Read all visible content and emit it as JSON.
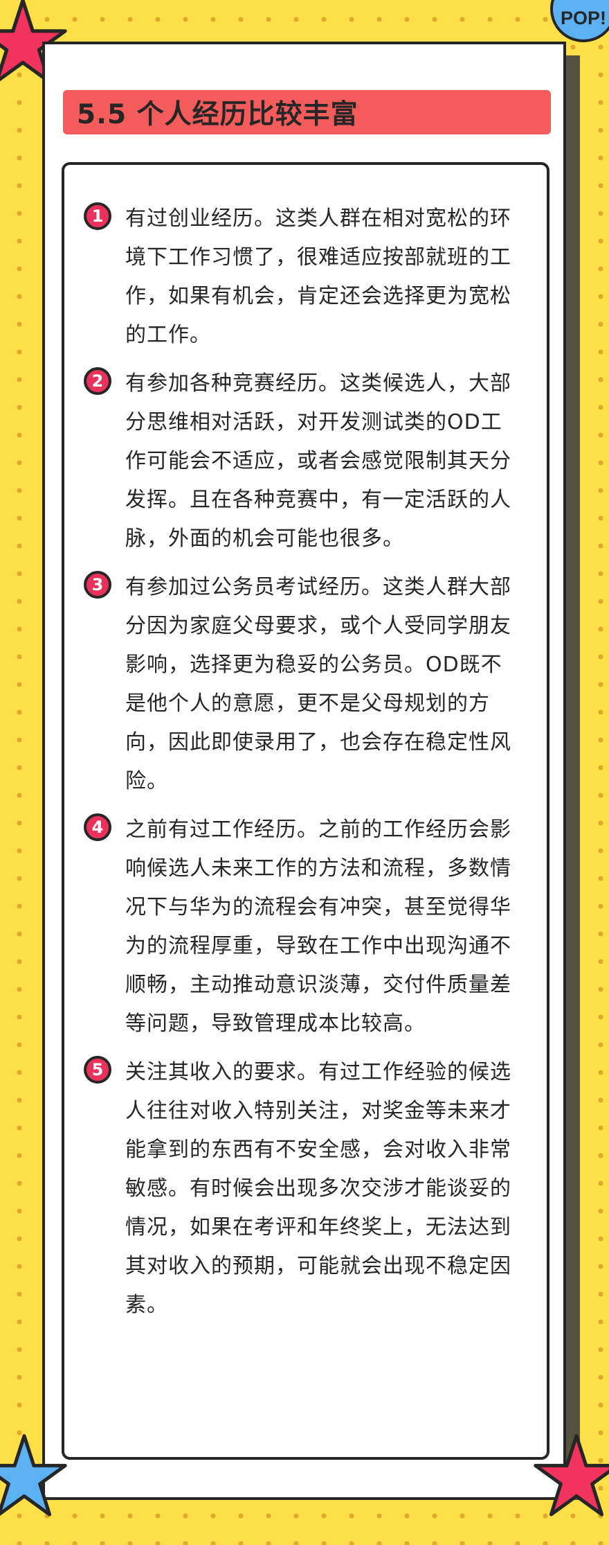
{
  "badge": {
    "label": "POP!"
  },
  "title": "5.5 个人经历比较丰富",
  "items": [
    {
      "number": "1",
      "text": "有过创业经历。这类人群在相对宽松的环境下工作习惯了，很难适应按部就班的工作，如果有机会，肯定还会选择更为宽松的工作。"
    },
    {
      "number": "2",
      "text": "有参加各种竞赛经历。这类候选人，大部分思维相对活跃，对开发测试类的OD工作可能会不适应，或者会感觉限制其天分发挥。且在各种竞赛中，有一定活跃的人脉，外面的机会可能也很多。"
    },
    {
      "number": "3",
      "text": "有参加过公务员考试经历。这类人群大部分因为家庭父母要求，或个人受同学朋友影响，选择更为稳妥的公务员。OD既不是他个人的意愿，更不是父母规划的方向，因此即使录用了，也会存在稳定性风险。"
    },
    {
      "number": "4",
      "text": "之前有过工作经历。之前的工作经历会影响候选人未来工作的方法和流程，多数情况下与华为的流程会有冲突，甚至觉得华为的流程厚重，导致在工作中出现沟通不顺畅，主动推动意识淡薄，交付件质量差等问题，导致管理成本比较高。"
    },
    {
      "number": "5",
      "text": "关注其收入的要求。有过工作经验的候选人往往对收入特别关注，对奖金等未来才能拿到的东西有不安全感，会对收入非常敏感。有时候会出现多次交涉才能谈妥的情况，如果在考评和年终奖上，无法达到其对收入的预期，可能就会出现不稳定因素。"
    }
  ],
  "colors": {
    "background": "#fde047",
    "accent": "#f45b5b",
    "number_badge": "#e8325c",
    "star_pink": "#f0345e",
    "star_blue": "#5cb1f2",
    "outline": "#262626"
  }
}
